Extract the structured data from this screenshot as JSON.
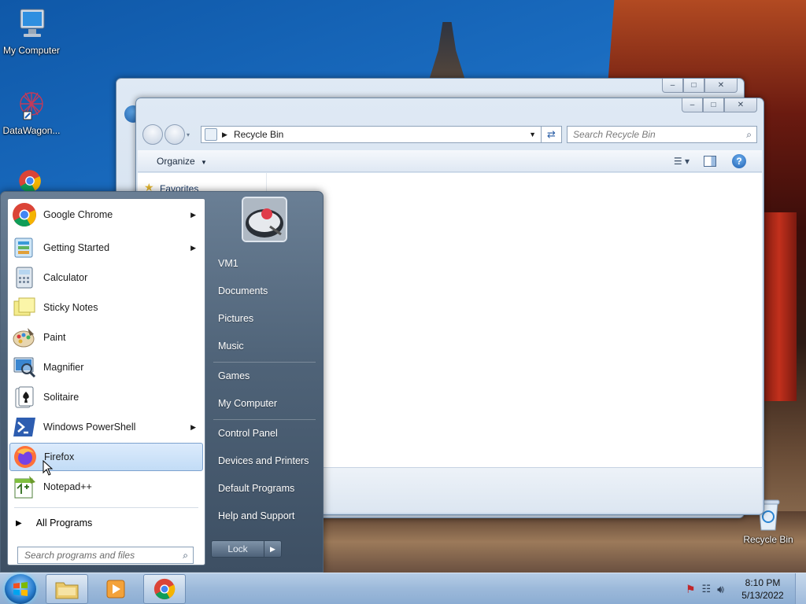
{
  "desktop": {
    "icons": [
      {
        "label": "My Computer"
      },
      {
        "label": "DataWagon..."
      },
      {
        "label": "Recycle Bin"
      }
    ]
  },
  "explorer": {
    "address": "Recycle Bin",
    "search_placeholder": "Search Recycle Bin",
    "organize_label": "Organize",
    "nav_favorites": "Favorites"
  },
  "start_menu": {
    "programs": [
      {
        "label": "Google Chrome",
        "submenu": true
      },
      {
        "label": "Getting Started",
        "submenu": true
      },
      {
        "label": "Calculator",
        "submenu": false
      },
      {
        "label": "Sticky Notes",
        "submenu": false
      },
      {
        "label": "Paint",
        "submenu": false
      },
      {
        "label": "Magnifier",
        "submenu": false
      },
      {
        "label": "Solitaire",
        "submenu": false
      },
      {
        "label": "Windows PowerShell",
        "submenu": true
      },
      {
        "label": "Firefox",
        "submenu": false
      },
      {
        "label": "Notepad++",
        "submenu": false
      }
    ],
    "all_programs": "All Programs",
    "search_placeholder": "Search programs and files",
    "user_name": "VM1",
    "right_items": [
      "Documents",
      "Pictures",
      "Music",
      "Games",
      "My Computer",
      "Control Panel",
      "Devices and Printers",
      "Default Programs",
      "Help and Support"
    ],
    "lock_label": "Lock"
  },
  "taskbar": {
    "time": "8:10 PM",
    "date": "5/13/2022"
  }
}
